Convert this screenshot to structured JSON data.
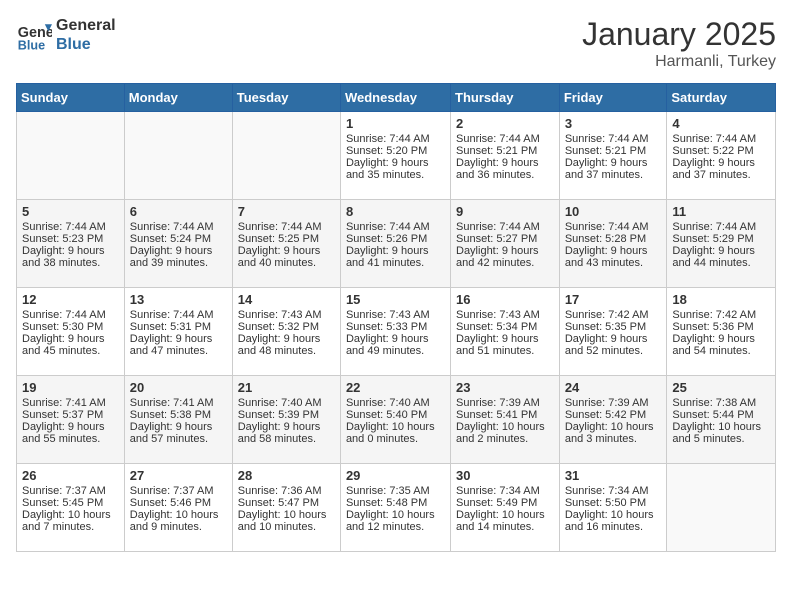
{
  "header": {
    "logo_line1": "General",
    "logo_line2": "Blue",
    "title": "January 2025",
    "subtitle": "Harmanli, Turkey"
  },
  "weekdays": [
    "Sunday",
    "Monday",
    "Tuesday",
    "Wednesday",
    "Thursday",
    "Friday",
    "Saturday"
  ],
  "weeks": [
    [
      {
        "day": "",
        "text": ""
      },
      {
        "day": "",
        "text": ""
      },
      {
        "day": "",
        "text": ""
      },
      {
        "day": "1",
        "text": "Sunrise: 7:44 AM\nSunset: 5:20 PM\nDaylight: 9 hours and 35 minutes."
      },
      {
        "day": "2",
        "text": "Sunrise: 7:44 AM\nSunset: 5:21 PM\nDaylight: 9 hours and 36 minutes."
      },
      {
        "day": "3",
        "text": "Sunrise: 7:44 AM\nSunset: 5:21 PM\nDaylight: 9 hours and 37 minutes."
      },
      {
        "day": "4",
        "text": "Sunrise: 7:44 AM\nSunset: 5:22 PM\nDaylight: 9 hours and 37 minutes."
      }
    ],
    [
      {
        "day": "5",
        "text": "Sunrise: 7:44 AM\nSunset: 5:23 PM\nDaylight: 9 hours and 38 minutes."
      },
      {
        "day": "6",
        "text": "Sunrise: 7:44 AM\nSunset: 5:24 PM\nDaylight: 9 hours and 39 minutes."
      },
      {
        "day": "7",
        "text": "Sunrise: 7:44 AM\nSunset: 5:25 PM\nDaylight: 9 hours and 40 minutes."
      },
      {
        "day": "8",
        "text": "Sunrise: 7:44 AM\nSunset: 5:26 PM\nDaylight: 9 hours and 41 minutes."
      },
      {
        "day": "9",
        "text": "Sunrise: 7:44 AM\nSunset: 5:27 PM\nDaylight: 9 hours and 42 minutes."
      },
      {
        "day": "10",
        "text": "Sunrise: 7:44 AM\nSunset: 5:28 PM\nDaylight: 9 hours and 43 minutes."
      },
      {
        "day": "11",
        "text": "Sunrise: 7:44 AM\nSunset: 5:29 PM\nDaylight: 9 hours and 44 minutes."
      }
    ],
    [
      {
        "day": "12",
        "text": "Sunrise: 7:44 AM\nSunset: 5:30 PM\nDaylight: 9 hours and 45 minutes."
      },
      {
        "day": "13",
        "text": "Sunrise: 7:44 AM\nSunset: 5:31 PM\nDaylight: 9 hours and 47 minutes."
      },
      {
        "day": "14",
        "text": "Sunrise: 7:43 AM\nSunset: 5:32 PM\nDaylight: 9 hours and 48 minutes."
      },
      {
        "day": "15",
        "text": "Sunrise: 7:43 AM\nSunset: 5:33 PM\nDaylight: 9 hours and 49 minutes."
      },
      {
        "day": "16",
        "text": "Sunrise: 7:43 AM\nSunset: 5:34 PM\nDaylight: 9 hours and 51 minutes."
      },
      {
        "day": "17",
        "text": "Sunrise: 7:42 AM\nSunset: 5:35 PM\nDaylight: 9 hours and 52 minutes."
      },
      {
        "day": "18",
        "text": "Sunrise: 7:42 AM\nSunset: 5:36 PM\nDaylight: 9 hours and 54 minutes."
      }
    ],
    [
      {
        "day": "19",
        "text": "Sunrise: 7:41 AM\nSunset: 5:37 PM\nDaylight: 9 hours and 55 minutes."
      },
      {
        "day": "20",
        "text": "Sunrise: 7:41 AM\nSunset: 5:38 PM\nDaylight: 9 hours and 57 minutes."
      },
      {
        "day": "21",
        "text": "Sunrise: 7:40 AM\nSunset: 5:39 PM\nDaylight: 9 hours and 58 minutes."
      },
      {
        "day": "22",
        "text": "Sunrise: 7:40 AM\nSunset: 5:40 PM\nDaylight: 10 hours and 0 minutes."
      },
      {
        "day": "23",
        "text": "Sunrise: 7:39 AM\nSunset: 5:41 PM\nDaylight: 10 hours and 2 minutes."
      },
      {
        "day": "24",
        "text": "Sunrise: 7:39 AM\nSunset: 5:42 PM\nDaylight: 10 hours and 3 minutes."
      },
      {
        "day": "25",
        "text": "Sunrise: 7:38 AM\nSunset: 5:44 PM\nDaylight: 10 hours and 5 minutes."
      }
    ],
    [
      {
        "day": "26",
        "text": "Sunrise: 7:37 AM\nSunset: 5:45 PM\nDaylight: 10 hours and 7 minutes."
      },
      {
        "day": "27",
        "text": "Sunrise: 7:37 AM\nSunset: 5:46 PM\nDaylight: 10 hours and 9 minutes."
      },
      {
        "day": "28",
        "text": "Sunrise: 7:36 AM\nSunset: 5:47 PM\nDaylight: 10 hours and 10 minutes."
      },
      {
        "day": "29",
        "text": "Sunrise: 7:35 AM\nSunset: 5:48 PM\nDaylight: 10 hours and 12 minutes."
      },
      {
        "day": "30",
        "text": "Sunrise: 7:34 AM\nSunset: 5:49 PM\nDaylight: 10 hours and 14 minutes."
      },
      {
        "day": "31",
        "text": "Sunrise: 7:34 AM\nSunset: 5:50 PM\nDaylight: 10 hours and 16 minutes."
      },
      {
        "day": "",
        "text": ""
      }
    ]
  ]
}
